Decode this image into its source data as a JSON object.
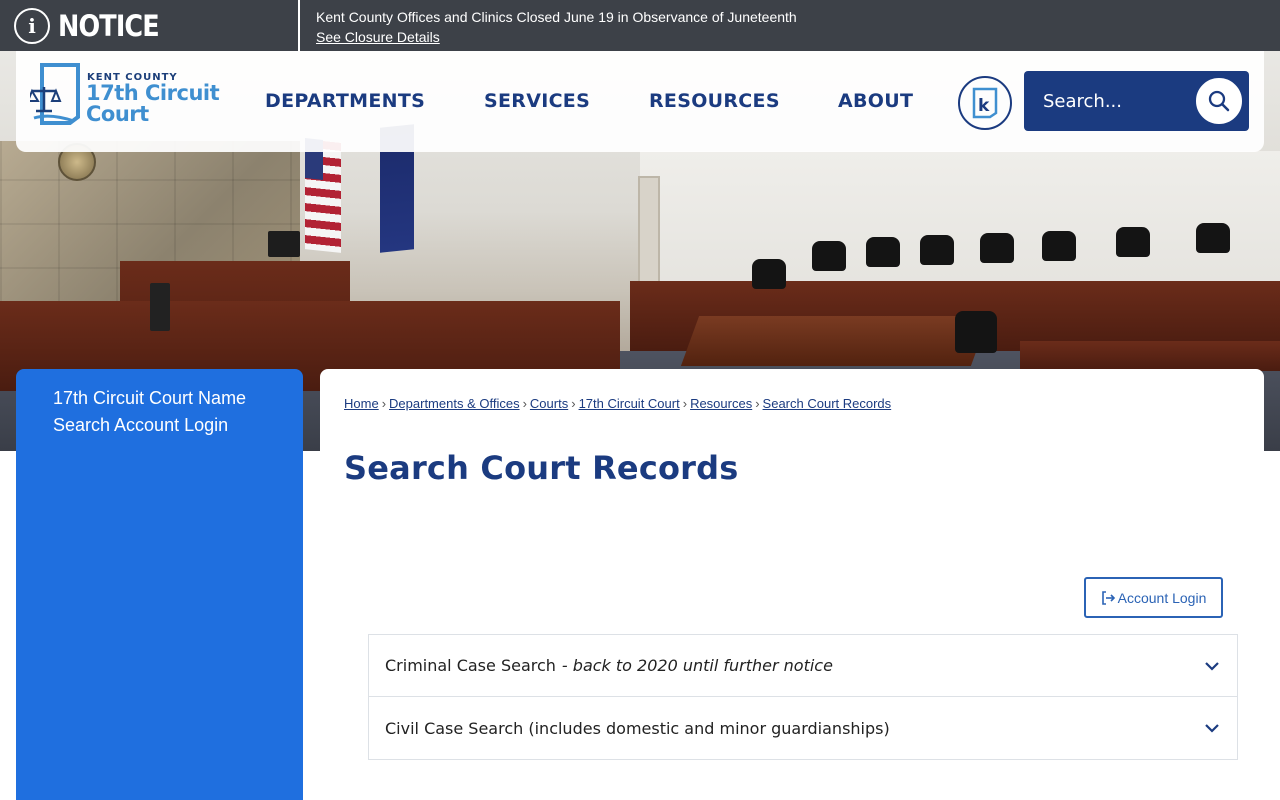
{
  "notice": {
    "label": "NOTICE",
    "message": "Kent County Offices and Clinics Closed June 19 in Observance of Juneteenth",
    "link_text": "See Closure Details"
  },
  "logo": {
    "small": "KENT COUNTY",
    "line1": "17th Circuit",
    "line2": "Court"
  },
  "nav": {
    "items": [
      "DEPARTMENTS",
      "SERVICES",
      "RESOURCES",
      "ABOUT"
    ]
  },
  "search": {
    "placeholder": "Search..."
  },
  "sidebar": {
    "link": "17th Circuit Court Name Search Account Login"
  },
  "breadcrumb": {
    "items": [
      "Home",
      "Departments & Offices",
      "Courts",
      "17th Circuit Court",
      "Resources",
      "Search Court Records"
    ],
    "separator": "›"
  },
  "page": {
    "title": "Search Court Records",
    "account_button": "Account Login"
  },
  "accordion": {
    "items": [
      {
        "label": "Criminal Case Search",
        "note": "- back to 2020 until further notice"
      },
      {
        "label": "Civil Case Search (includes domestic and minor guardianships)",
        "note": ""
      }
    ]
  },
  "colors": {
    "brand_navy": "#1b3b80",
    "sidebar_blue": "#1f6fdf",
    "notice_bg": "#3d4148",
    "button_blue": "#2b63b5"
  }
}
